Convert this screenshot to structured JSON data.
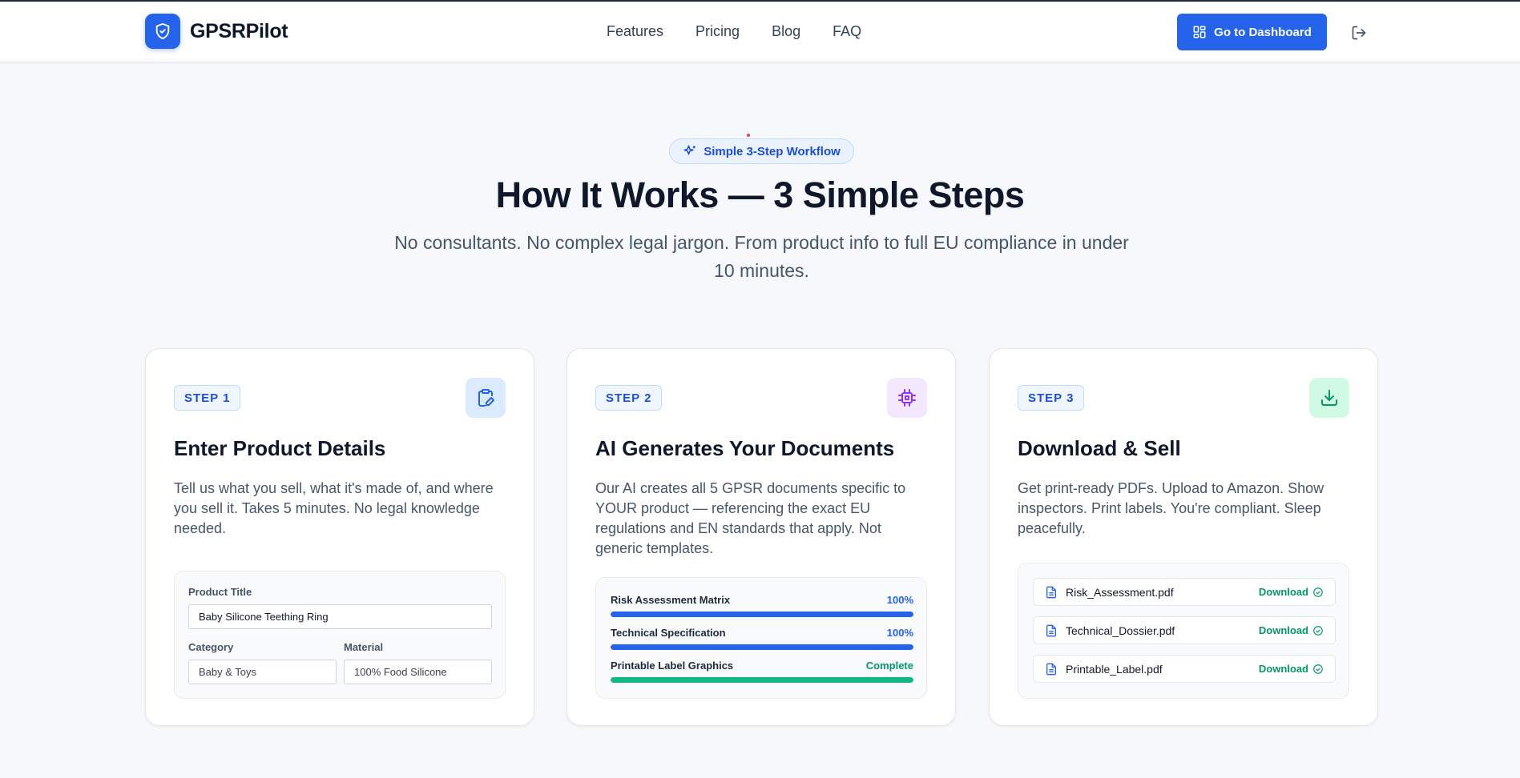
{
  "header": {
    "brand": "GPSRPilot",
    "nav": [
      "Features",
      "Pricing",
      "Blog",
      "FAQ"
    ],
    "dashboard_button": "Go to Dashboard",
    "accent_color": "#2563eb"
  },
  "hero": {
    "badge": "Simple 3-Step Workflow",
    "title": "How It Works — 3 Simple Steps",
    "subtitle": "No consultants. No complex legal jargon. From product info to full EU compliance in under 10 minutes."
  },
  "steps": [
    {
      "tag": "STEP 1",
      "icon": "clipboard-edit-icon",
      "title": "Enter Product Details",
      "description": "Tell us what you sell, what it's made of, and where you sell it. Takes 5 minutes. No legal knowledge needed.",
      "form": {
        "product_title_label": "Product Title",
        "product_title_value": "Baby Silicone Teething Ring",
        "category_label": "Category",
        "category_value": "Baby & Toys",
        "material_label": "Material",
        "material_value": "100% Food Silicone"
      }
    },
    {
      "tag": "STEP 2",
      "icon": "cpu-chip-icon",
      "title": "AI Generates Your Documents",
      "description": "Our AI creates all 5 GPSR documents specific to YOUR product — referencing the exact EU regulations and EN standards that apply. Not generic templates.",
      "progress": [
        {
          "label": "Risk Assessment Matrix",
          "status": "100%",
          "value": 100
        },
        {
          "label": "Technical Specification",
          "status": "100%",
          "value": 100
        },
        {
          "label": "Printable Label Graphics",
          "status": "Complete",
          "value": 100
        }
      ]
    },
    {
      "tag": "STEP 3",
      "icon": "download-icon",
      "title": "Download & Sell",
      "description": "Get print-ready PDFs. Upload to Amazon. Show inspectors. Print labels. You're compliant. Sleep peacefully.",
      "files": [
        {
          "name": "Risk_Assessment.pdf",
          "action": "Download"
        },
        {
          "name": "Technical_Dossier.pdf",
          "action": "Download"
        },
        {
          "name": "Printable_Label.pdf",
          "action": "Download"
        }
      ]
    }
  ]
}
